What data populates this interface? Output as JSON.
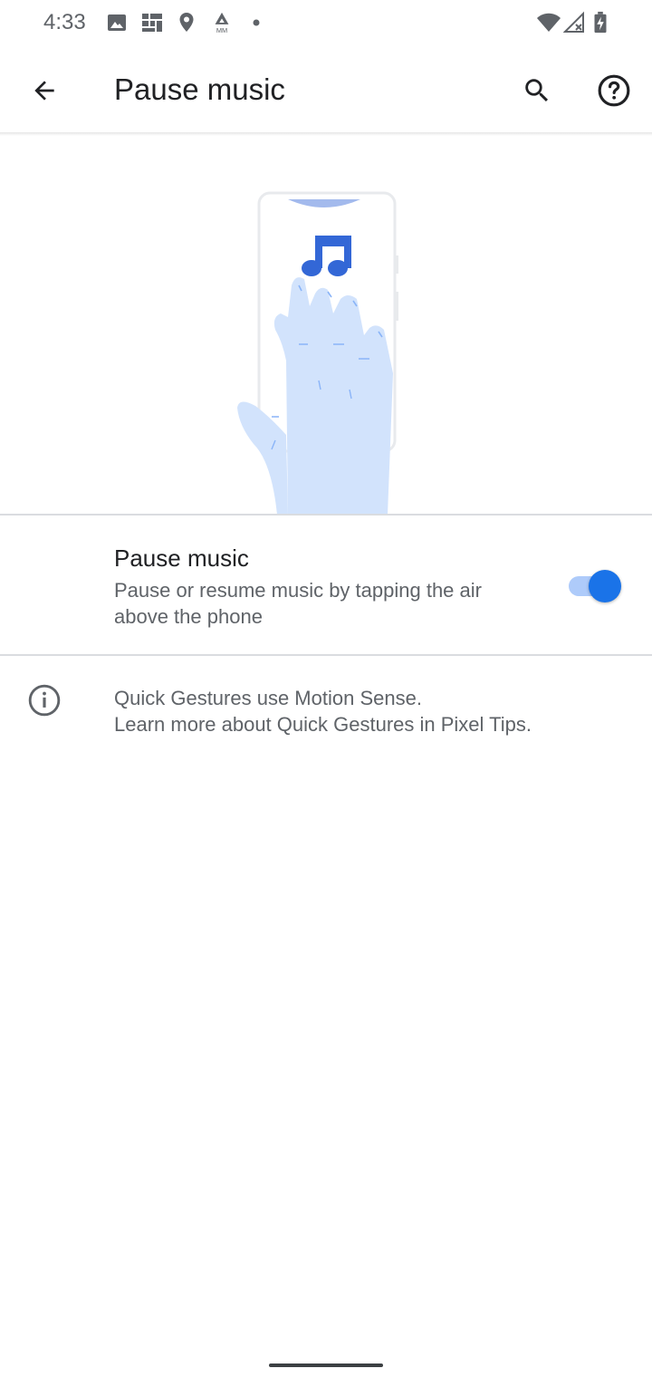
{
  "status_bar": {
    "time": "4:33",
    "left_icons": [
      "image-icon",
      "grid-app-icon",
      "location-icon",
      "amazon-music-icon",
      "notification-dot-icon"
    ],
    "right_icons": [
      "wifi-icon",
      "no-signal-icon",
      "battery-charging-icon"
    ]
  },
  "app_bar": {
    "title": "Pause music",
    "icons": [
      "back-arrow-icon",
      "search-icon",
      "help-icon"
    ]
  },
  "illustration": {
    "icons": [
      "music-note-icon",
      "phone-outline",
      "hand-gesture"
    ],
    "accent_color": "#3367d6",
    "hand_color": "#d2e3fc"
  },
  "setting": {
    "title": "Pause music",
    "summary": "Pause or resume music by tapping the air above the phone",
    "toggle_on": true,
    "toggle_color": "#1a73e8"
  },
  "footer": {
    "line1": "Quick Gestures use Motion Sense.",
    "line2": "Learn more about Quick Gestures in Pixel Tips."
  }
}
